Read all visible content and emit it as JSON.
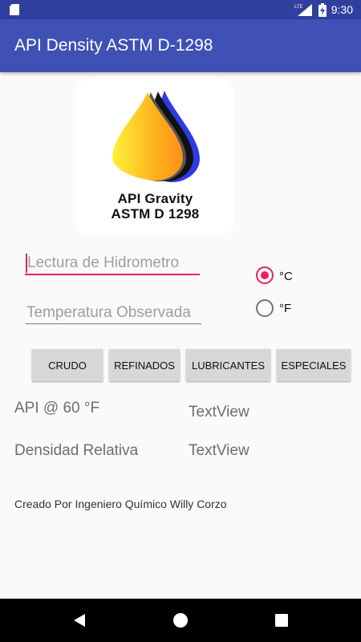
{
  "status_bar": {
    "network": "LTE",
    "time": "9:30",
    "icons": [
      "sim-card-icon",
      "lte-signal-icon",
      "battery-charging-icon"
    ]
  },
  "app_bar": {
    "title": "API Density ASTM D-1298"
  },
  "logo": {
    "line1": "API Gravity",
    "line2": "ASTM D 1298"
  },
  "inputs": {
    "hydrometer_placeholder": "Lectura de Hidrometro",
    "temperature_placeholder": "Temperatura Observada"
  },
  "units": {
    "celsius_label": "°C",
    "fahrenheit_label": "°F",
    "selected": "celsius"
  },
  "buttons": {
    "crudo": "CRUDO",
    "refinados": "REFINADOS",
    "lubricantes": "LUBRICANTES",
    "especiales": "ESPECIALES"
  },
  "results": {
    "api_label": "API @ 60 °F",
    "api_value": "TextView",
    "density_label": "Densidad Relativa",
    "density_value": "TextView"
  },
  "credit": "Creado Por Ingeniero Químico Willy Corzo",
  "colors": {
    "primary": "#3f51b5",
    "primary_dark": "#303f9f",
    "accent": "#e91e63"
  },
  "nav_bar": {
    "icons": [
      "back-icon",
      "home-icon",
      "recents-icon"
    ]
  }
}
